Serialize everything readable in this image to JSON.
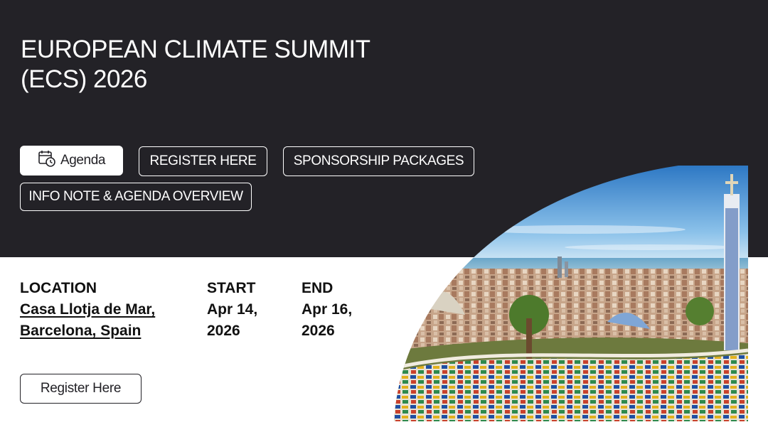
{
  "event": {
    "title_line1": "EUROPEAN CLIMATE SUMMIT",
    "title_line2": "(ECS) 2026"
  },
  "buttons": {
    "agenda": "Agenda",
    "register_top": "REGISTER HERE",
    "sponsorship": "SPONSORSHIP PACKAGES",
    "info_note": "INFO NOTE & AGENDA OVERVIEW",
    "register_bottom": "Register Here"
  },
  "details": {
    "location_label": "LOCATION",
    "location_line1": "Casa Llotja de Mar,",
    "location_line2": "Barcelona, Spain",
    "start_label": "START",
    "start_line1": "Apr 14,",
    "start_line2": "2026",
    "end_label": "END",
    "end_line1": "Apr 16,",
    "end_line2": "2026"
  },
  "image": {
    "subject": "barcelona-park-guell-photo"
  },
  "colors": {
    "hero_bg": "#232227",
    "text_dark": "#111111",
    "white": "#ffffff"
  }
}
